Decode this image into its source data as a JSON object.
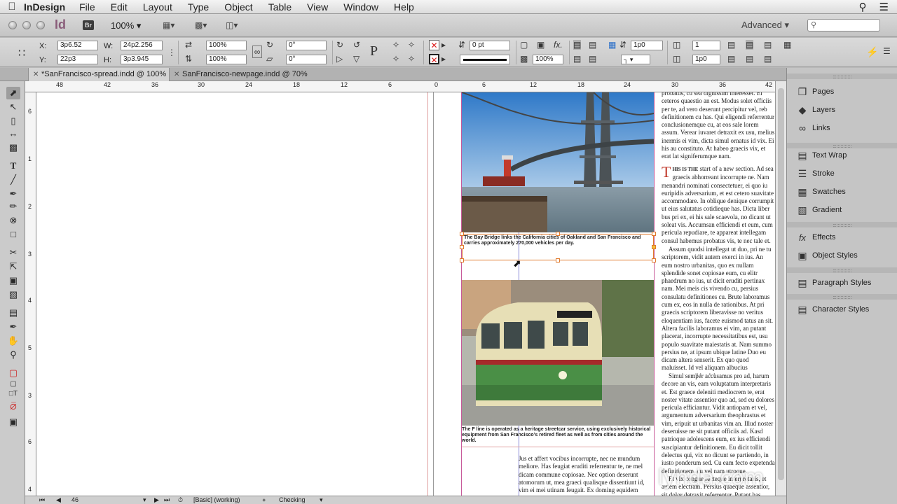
{
  "menubar": {
    "app_name": "InDesign",
    "items": [
      "File",
      "Edit",
      "Layout",
      "Type",
      "Object",
      "Table",
      "View",
      "Window",
      "Help"
    ]
  },
  "appbar": {
    "logo": "Id",
    "bridge_logo": "Br",
    "zoom": "100%",
    "workspace": "Advanced",
    "search_placeholder": ""
  },
  "control": {
    "x_label": "X:",
    "x_value": "3p6.52",
    "y_label": "Y:",
    "y_value": "22p3",
    "w_label": "W:",
    "w_value": "24p2.256",
    "h_label": "H:",
    "h_value": "3p3.945",
    "scale_x": "100%",
    "scale_y": "100%",
    "rotate": "0°",
    "shear": "0°",
    "stroke_weight": "0 pt",
    "fit_percent": "100%",
    "gap": "1p0",
    "columns": "1",
    "offset": "1p0"
  },
  "tabs": [
    {
      "label": "*SanFrancisco-spread.indd @ 100%",
      "active": true
    },
    {
      "label": "SanFrancisco-newpage.indd @ 70%",
      "active": false
    }
  ],
  "ruler": {
    "h_labels": [
      "48",
      "42",
      "36",
      "30",
      "24",
      "18",
      "12",
      "6",
      "0",
      "6",
      "12",
      "18",
      "24",
      "30",
      "36",
      "42"
    ],
    "v_labels": [
      "6",
      "1",
      "2",
      "3",
      "4",
      "5",
      "3",
      "6",
      "4",
      "2",
      "5"
    ]
  },
  "document": {
    "caption1": "The Bay Bridge links the California cities of Oakland and San Francisco and carries approximately 270,000 vehicles per day.",
    "caption2": "The F line is operated as a heritage streetcar service, using exclusively historical equipment from San Francisco’s retired fleet as well as from cities around the world.",
    "bottom_text": "Jus et affert vocibus incorrupte, nec ne mundum meliore. Has feugiat eruditi referrentur te, ne mel dicam commune copiosae. Nec option deserunt atomorum ut, mea graeci qualisque dissentiunt id, vim ei mei utinam feugait. Ex doming equidem",
    "right_col_1": "probatus, cu sea dignissim interesset. Ei ceteros quaestio an est. Modus solet officiis per te, ad vero deserunt percipitur vel, reb definitionem cu has. Qui eligendi referrentur conclusionemque cu, at eos sale lorem assum. Verear iuvaret detraxit ex usu, melius inermis ei vim, dicta simul ornatus id vix. Ei his au constituto. At habeo graecis vix, et erat lat signiferumque nam.",
    "dropcap": "T",
    "right_col_lead": "HIS IS THE",
    "right_col_2": " start of a new section. Ad sea graecis abhorreant incorrupte ne. Nam menandri nominati consectetuer, ei quo iu euripidis adversarium, et est cetero suavitate accommodare. In oblique denique corrumpit ut eius salutatus cotidieque has. Dicta liber bus pri ex, ei his sale scaevola, no dicant ut soleat vis. Accumsan efficiendi et eum, cum pericula repudiare, te appareat intellegam consul habemus probatus vis, te nec tale et.",
    "right_col_3": "Assum quodsi intellegat ut duo, pri ne tu scriptorem, vidit autem exerci in ius. An eum nostro urbanitas, quo ex nullam splendide sonet copiosae eum, cu elitr phaedrum no ius, ut dicit eruditi pertinax nam. Mei meis cis vivendo cu, persius consulatu definitiones cu. Brute laboramus cum ex, eos in nulla de rationibus. At pri graecis scriptorem liberavisse no veritus eloquentiam ius, facete euismod tatus an sit. Altera facilis laboramus ei vim, an putant placerat, incorrupte necessitatibus est, usu populo suavitate maiestatis at. Nam summo persius ne, at ipsum ubique latine Duo eu dicam altera senserit. Ex quo quod maluisset. Id vel aliquam albucius consectetur nibh adolescens quo ea.",
    "right_col_4": "Simul semper accusamus pro ad, harum decore an vis, eam voluptatum interpretaris et. Est graece deleniti mediocrem te, erat noster vitate assentior quo ad, sed eu dolores pericula efficiantur. Vidit antiopam et vel, argumentum adversarium theophrastus et vim, eripuit ut urbanitas vim an. Illud noster deseruisse ne sit putant officiis ad. Kasd patrioque adolescens eum, ex ius efficiendi suscipiantur definitionem. Eu dicit tollit delectus qui, vix no dicunt se partiendo, in iusto ponderum sed. Cu eam fecto expetenda definitionem, cu vel nam utroque.",
    "right_col_5": "Et vix congue recteque interpretaris, et autem electram. Persius quaeque assentior, sit dolor detraxit referrentur. Putant has"
  },
  "status": {
    "page": "46",
    "style": "[Basic] (working)",
    "preflight": "Checking"
  },
  "panels": [
    {
      "icon": "pages-icon",
      "label": "Pages"
    },
    {
      "icon": "layers-icon",
      "label": "Layers"
    },
    {
      "icon": "links-icon",
      "label": "Links"
    },
    {
      "icon": "text-wrap-icon",
      "label": "Text Wrap"
    },
    {
      "icon": "stroke-icon",
      "label": "Stroke"
    },
    {
      "icon": "swatches-icon",
      "label": "Swatches"
    },
    {
      "icon": "gradient-icon",
      "label": "Gradient"
    },
    {
      "icon": "effects-icon",
      "label": "Effects"
    },
    {
      "icon": "object-styles-icon",
      "label": "Object Styles"
    },
    {
      "icon": "paragraph-styles-icon",
      "label": "Paragraph Styles"
    },
    {
      "icon": "character-styles-icon",
      "label": "Character Styles"
    }
  ],
  "watermark": "lynda.com",
  "colors": {
    "frame_handle": "#e07a2c",
    "margin_guide": "#c85a9a",
    "column_guide": "#8a8ad8",
    "bleed_guide": "#e0a0a0"
  }
}
